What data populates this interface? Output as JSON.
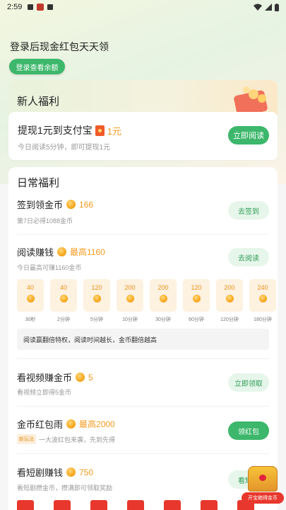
{
  "status_bar": {
    "time": "2:59"
  },
  "header": {
    "login_title": "登录后现金红包天天领",
    "login_button": "登录查看余额"
  },
  "newbie": {
    "title": "新人福利",
    "withdraw_title": "提现1元到支付宝",
    "withdraw_amount": "1元",
    "withdraw_sub": "今日阅读5分钟，即可提现1元",
    "button": "立即阅读"
  },
  "daily": {
    "title": "日常福利",
    "signin": {
      "title": "签到领金币",
      "value": "166",
      "sub": "第7日必得1088金币",
      "button": "去签到"
    },
    "reading": {
      "title": "阅读赚钱",
      "value": "最高1160",
      "sub": "今日最高可赚1160金币",
      "button": "去阅读",
      "milestones": [
        {
          "amount": "40",
          "label": "30秒"
        },
        {
          "amount": "40",
          "label": "2分钟"
        },
        {
          "amount": "120",
          "label": "5分钟"
        },
        {
          "amount": "200",
          "label": "10分钟"
        },
        {
          "amount": "200",
          "label": "30分钟"
        },
        {
          "amount": "120",
          "label": "60分钟"
        },
        {
          "amount": "200",
          "label": "120分钟"
        },
        {
          "amount": "240",
          "label": "180分钟"
        }
      ],
      "tip": "阅读赢翻倍特权，阅读时间越长，金币翻倍越高"
    },
    "video": {
      "title": "看视频赚金币",
      "value": "5",
      "sub": "看视频立即得5金币",
      "button": "立即领取"
    },
    "rain": {
      "title": "金币红包雨",
      "value": "最高2000",
      "tag": "新玩法",
      "sub": "一大波红包来袭，先到先得",
      "button": "领红包"
    },
    "drama": {
      "title": "看短剧赚钱",
      "value": "750",
      "sub": "看短剧攒金币，攒满即可领取奖励",
      "button": "看短剧"
    }
  },
  "float_chest": {
    "label": "开宝箱得金币"
  },
  "colors": {
    "accent_green": "#3cb76b",
    "coin_orange": "#f39a1e",
    "red": "#e8372c"
  }
}
